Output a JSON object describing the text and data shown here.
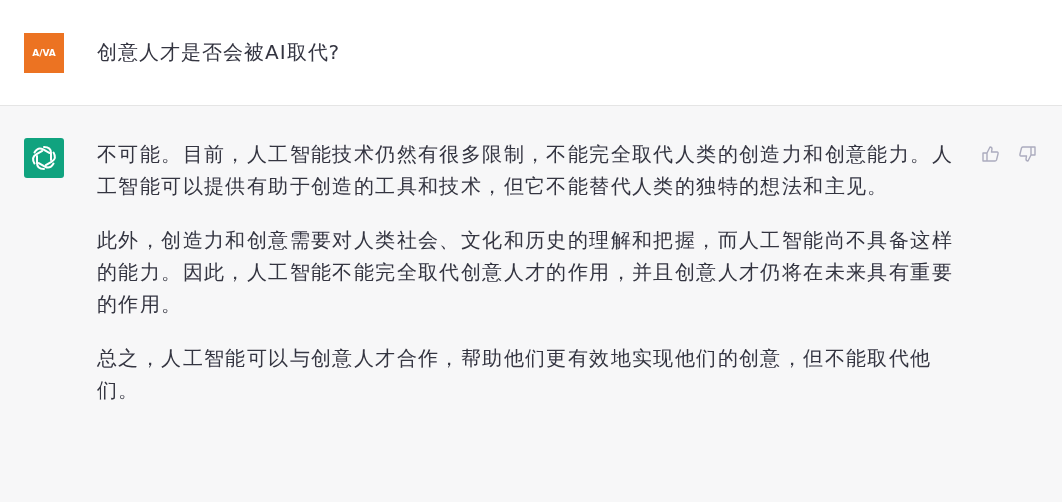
{
  "user_message": {
    "avatar_text": "A/VA",
    "text": "创意人才是否会被AI取代?"
  },
  "assistant_message": {
    "paragraphs": [
      "不可能。目前，人工智能技术仍然有很多限制，不能完全取代人类的创造力和创意能力。人工智能可以提供有助于创造的工具和技术，但它不能替代人类的独特的想法和主见。",
      "此外，创造力和创意需要对人类社会、文化和历史的理解和把握，而人工智能尚不具备这样的能力。因此，人工智能不能完全取代创意人才的作用，并且创意人才仍将在未来具有重要的作用。",
      "总之，人工智能可以与创意人才合作，帮助他们更有效地实现他们的创意，但不能取代他们。"
    ]
  }
}
